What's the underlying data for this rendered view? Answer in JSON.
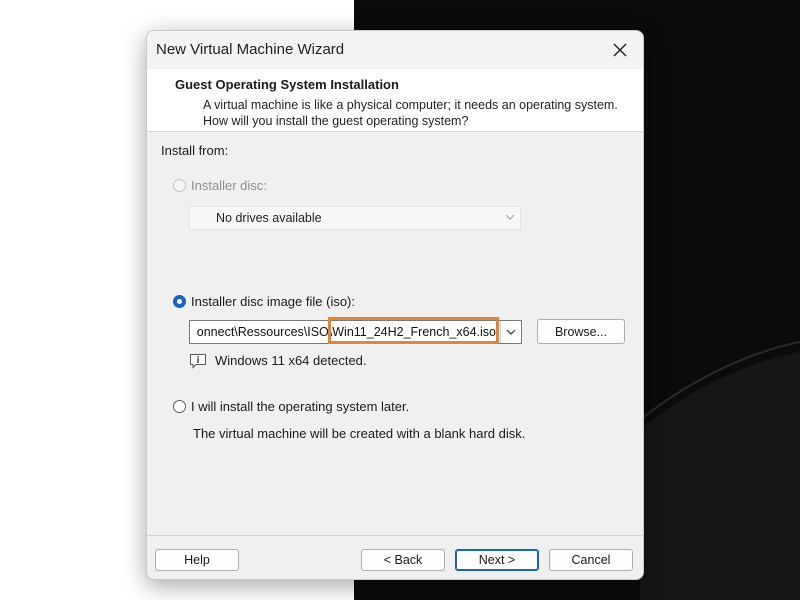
{
  "window": {
    "title": "New Virtual Machine Wizard"
  },
  "header": {
    "title": "Guest Operating System Installation",
    "description": "A virtual machine is like a physical computer; it needs an operating system. How will you install the guest operating system?"
  },
  "install": {
    "label": "Install from:",
    "options": [
      {
        "label": "Installer disc:",
        "selected": false,
        "enabled": false
      },
      {
        "label": "Installer disc image file (iso):",
        "selected": true,
        "enabled": true
      },
      {
        "label": "I will install the operating system later.",
        "selected": false,
        "enabled": true
      }
    ],
    "disc_select_value": "No drives available",
    "iso_path_visible": "onnect\\Ressources\\ISO\\Win11_24H2_French_x64.iso",
    "detected_message": "Windows 11 x64 detected.",
    "later_note": "The virtual machine will be created with a blank hard disk."
  },
  "buttons": {
    "browse": "Browse...",
    "help": "Help",
    "back": "< Back",
    "next": "Next >",
    "cancel": "Cancel"
  },
  "colors": {
    "accent": "#1a62c6",
    "highlight": "#e8832e",
    "dialog_bg": "#f0f0f0",
    "header_bg": "#ffffff",
    "desktop_dark": "#0b0b0b"
  },
  "icons": {
    "close": "close-icon",
    "dropdown": "chevron-down-icon",
    "info": "info-icon"
  }
}
